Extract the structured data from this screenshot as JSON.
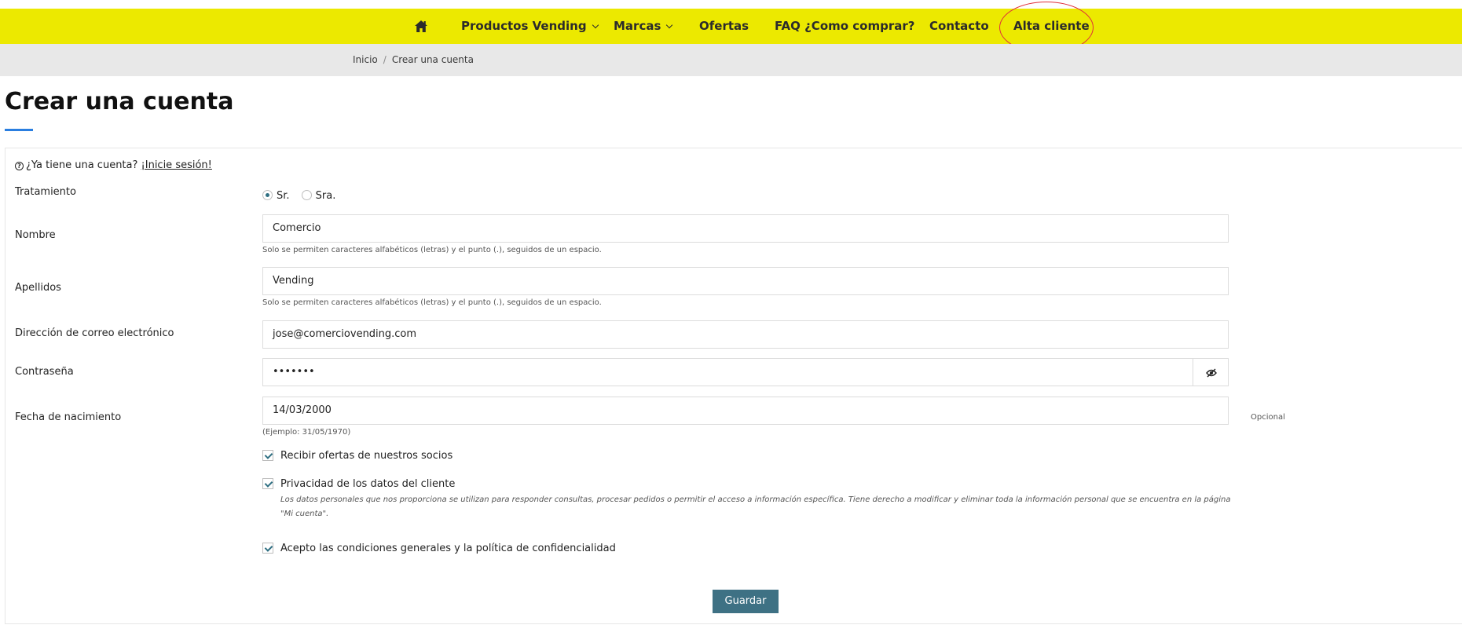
{
  "nav": {
    "items": [
      {
        "label": "Productos Vending",
        "dropdown": true
      },
      {
        "label": "Marcas",
        "dropdown": true
      },
      {
        "label": "Ofertas"
      },
      {
        "label": "FAQ ¿Como comprar?"
      },
      {
        "label": "Contacto"
      },
      {
        "label": "Alta cliente"
      }
    ],
    "home_icon": "home-icon"
  },
  "breadcrumb": {
    "items": [
      "Inicio",
      "Crear una cuenta"
    ],
    "separator": "/"
  },
  "page": {
    "title": "Crear una cuenta"
  },
  "form": {
    "login_prompt": "¿Ya tiene una cuenta?",
    "login_link": "¡Inicie sesión!",
    "tratamiento": {
      "label": "Tratamiento",
      "options": [
        "Sr.",
        "Sra."
      ],
      "selected": "Sr."
    },
    "nombre": {
      "label": "Nombre",
      "value": "Comercio",
      "hint": "Solo se permiten caracteres alfabéticos (letras) y el punto (.), seguidos de un espacio."
    },
    "apellidos": {
      "label": "Apellidos",
      "value": "Vending",
      "hint": "Solo se permiten caracteres alfabéticos (letras) y el punto (.), seguidos de un espacio."
    },
    "email": {
      "label": "Dirección de correo electrónico",
      "value": "jose@comerciovending.com"
    },
    "password": {
      "label": "Contraseña",
      "value": "•••••••"
    },
    "birthdate": {
      "label": "Fecha de nacimiento",
      "value": "14/03/2000",
      "hint": "(Ejemplo: 31/05/1970)",
      "optional": "Opcional"
    },
    "checkboxes": {
      "offers": "Recibir ofertas de nuestros socios",
      "privacy": "Privacidad de los datos del cliente",
      "privacy_note": "Los datos personales que nos proporciona se utilizan para responder consultas, procesar pedidos o permitir el acceso a información específica. Tiene derecho a modificar y eliminar toda la información personal que se encuentra en la página \"Mi cuenta\".",
      "terms": "Acepto las condiciones generales y la política de confidencialidad"
    },
    "save_label": "Guardar"
  },
  "colors": {
    "navbar_bg": "#ece900",
    "accent_underline": "#2a7ee0",
    "button_bg": "#3e7184",
    "highlight_ring": "#e0303a"
  }
}
